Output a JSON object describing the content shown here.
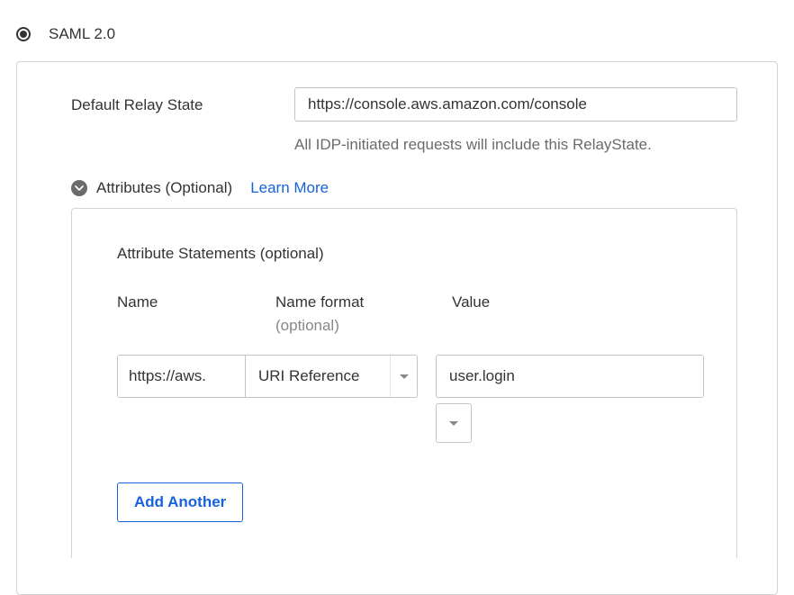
{
  "protocol": {
    "label": "SAML 2.0"
  },
  "relayState": {
    "label": "Default Relay State",
    "value": "https://console.aws.amazon.com/console",
    "helper": "All IDP-initiated requests will include this RelayState."
  },
  "attributes": {
    "sectionLabel": "Attributes (Optional)",
    "learnMore": "Learn More",
    "subTitle": "Attribute Statements (optional)",
    "columns": {
      "name": "Name",
      "format": "Name format",
      "formatSub": "(optional)",
      "value": "Value"
    },
    "row": {
      "name": "https://aws.",
      "format": "URI Reference",
      "value": "user.login"
    },
    "addAnother": "Add Another"
  }
}
